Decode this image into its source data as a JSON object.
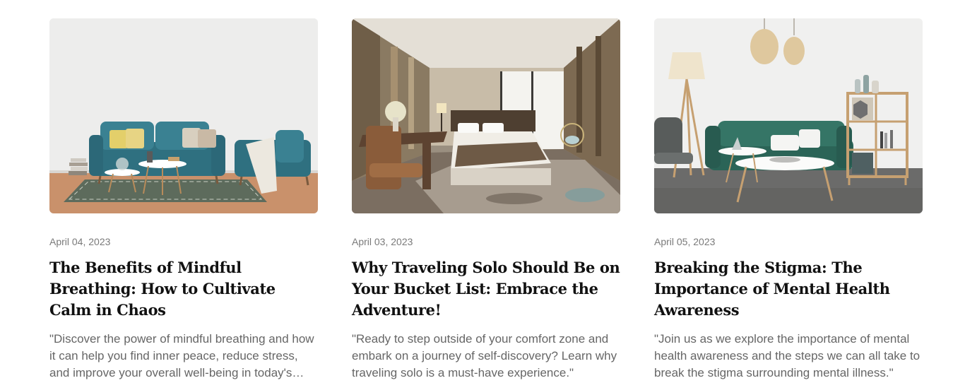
{
  "posts": [
    {
      "date": "April 04, 2023",
      "title": "The Benefits of Mindful Breathing: How to Cultivate Calm in Chaos",
      "excerpt": "\"Discover the power of mindful breathing and how it can help you find inner peace, reduce stress, and improve your overall well-being in today's busy world.\"",
      "image": "living-room-teal-sofa-image"
    },
    {
      "date": "April 03, 2023",
      "title": "Why Traveling Solo Should Be on Your Bucket List: Embrace the Adventure!",
      "excerpt": "\"Ready to step outside of your comfort zone and embark on a journey of self-discovery? Learn why traveling solo is a must-have experience.\"",
      "image": "hotel-bedroom-image"
    },
    {
      "date": "April 05, 2023",
      "title": "Breaking the Stigma: The Importance of Mental Health Awareness",
      "excerpt": "\"Join us as we explore the importance of mental health awareness and the steps we can all take to break the stigma surrounding mental illness.\"",
      "image": "modern-lounge-green-sofa-image"
    }
  ]
}
